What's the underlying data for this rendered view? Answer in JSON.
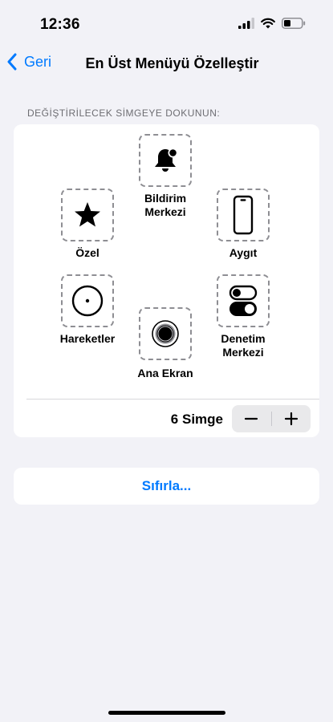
{
  "status_bar": {
    "time": "12:36"
  },
  "nav": {
    "back_label": "Geri",
    "title": "En Üst Menüyü Özelleştir"
  },
  "section_header": "DEĞİŞTİRİLECEK SİMGEYE DOKUNUN:",
  "slots": {
    "notification_center": {
      "label": "Bildirim\nMerkezi",
      "icon": "bell-badge-icon"
    },
    "custom": {
      "label": "Özel",
      "icon": "star-icon"
    },
    "device": {
      "label": "Aygıt",
      "icon": "iphone-icon"
    },
    "gestures": {
      "label": "Hareketler",
      "icon": "circle-dot-icon"
    },
    "control_center": {
      "label": "Denetim\nMerkezi",
      "icon": "toggles-icon"
    },
    "home": {
      "label": "Ana Ekran",
      "icon": "home-button-icon"
    }
  },
  "icon_count": {
    "label": "6 Simge",
    "decrement": "−",
    "increment": "+"
  },
  "reset": {
    "label": "Sıfırla..."
  },
  "colors": {
    "accent": "#007aff",
    "background": "#f2f2f7"
  }
}
